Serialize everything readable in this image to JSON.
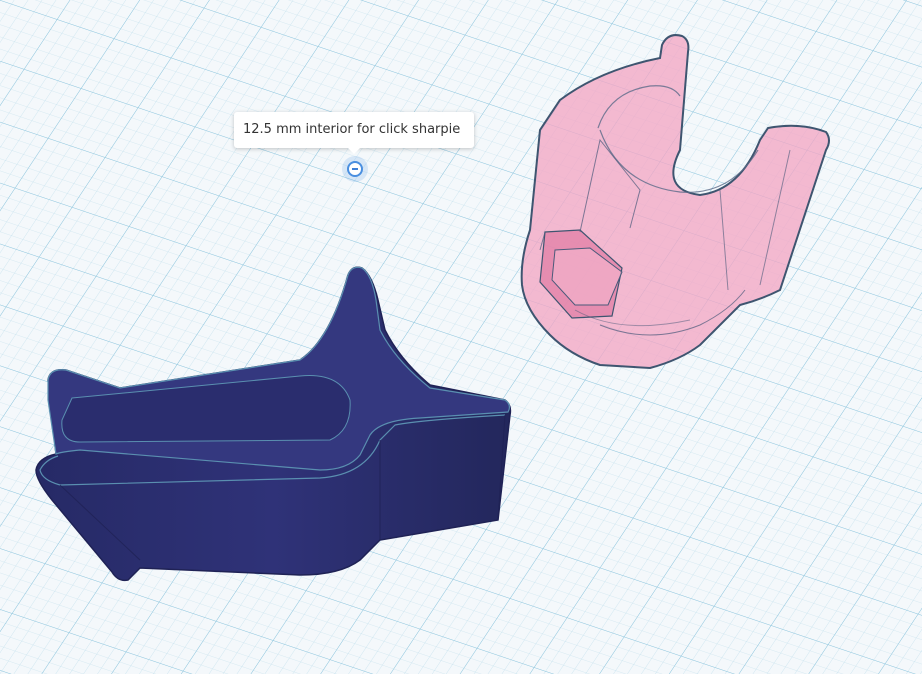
{
  "viewport": {
    "background_color": "#f4f8fb",
    "grid_minor_color": "#b9dcea",
    "grid_major_color": "#8fc6de"
  },
  "note": {
    "text": "12.5 mm interior for click sharpie",
    "pin_icon": "minus-circle-icon",
    "pin_color": "#4a8fe0"
  },
  "shapes": {
    "clip_solid": {
      "color": "#2f3278",
      "edge_color": "#5a8fb0"
    },
    "holder_hole": {
      "color": "#f2a7c4",
      "edge_color": "#3e5570"
    }
  }
}
